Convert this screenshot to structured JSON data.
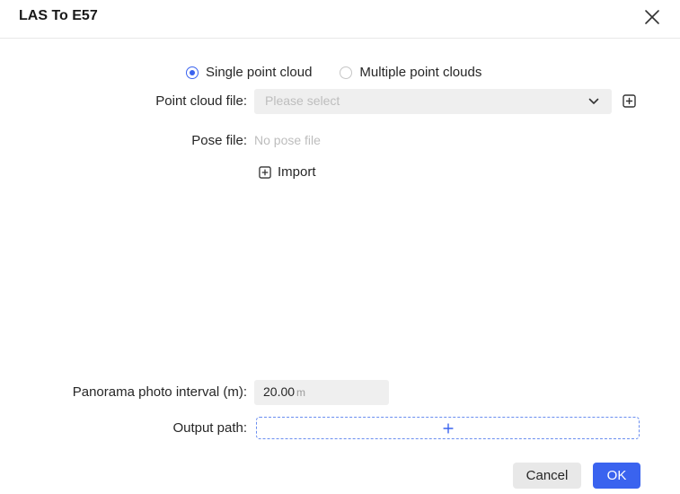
{
  "dialog": {
    "title": "LAS To E57"
  },
  "mode": {
    "options": [
      {
        "label": "Single point cloud",
        "checked": true
      },
      {
        "label": "Multiple point clouds",
        "checked": false
      }
    ]
  },
  "point_cloud_file": {
    "label": "Point cloud file:",
    "placeholder": "Please select"
  },
  "pose_file": {
    "label": "Pose file:",
    "value": "No pose file"
  },
  "import": {
    "label": "Import"
  },
  "panorama_interval": {
    "label": "Panorama photo interval (m):",
    "value": "20.00",
    "unit": "m"
  },
  "output_path": {
    "label": "Output path:"
  },
  "footer": {
    "cancel_label": "Cancel",
    "ok_label": "OK"
  },
  "colors": {
    "accent": "#3a63ef",
    "input_bg": "#efefef",
    "placeholder": "#bdbdbd",
    "dashed_border": "#6a8ef0"
  },
  "icons": {
    "close": "close-icon",
    "chevron": "chevron-down-icon",
    "add": "plus-square-icon",
    "plus": "plus-icon"
  }
}
